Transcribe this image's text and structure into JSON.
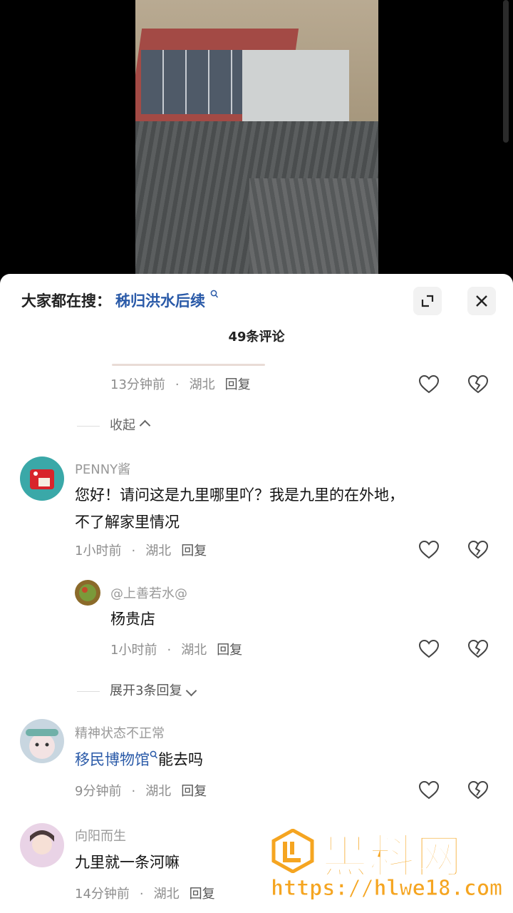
{
  "search_bar": {
    "prefix": "大家都在搜：",
    "keyword": "秭归洪水后续"
  },
  "comment_count": "49条评论",
  "collapse_label": "收起",
  "expand_label": "展开3条回复",
  "comments": [
    {
      "time": "13分钟前",
      "location": "湖北",
      "reply": "回复"
    },
    {
      "username": "PENNY酱",
      "text_line1": "您好！请问这是九里哪里吖？我是九里的在外地，",
      "text_line2": "不了解家里情况",
      "time": "1小时前",
      "location": "湖北",
      "reply": "回复"
    },
    {
      "username": "@上善若水@",
      "text": "杨贵店",
      "time": "1小时前",
      "location": "湖北",
      "reply": "回复"
    },
    {
      "username": "精神状态不正常",
      "link": "移民博物馆",
      "text": "能去吗",
      "time": "9分钟前",
      "location": "湖北",
      "reply": "回复"
    },
    {
      "username": "向阳而生",
      "text": "九里就一条河嘛",
      "time": "14分钟前",
      "location": "湖北",
      "reply": "回复"
    }
  ],
  "watermark": {
    "title": "黑料网",
    "url": "https://hlwe18.com"
  },
  "icons": {
    "search_small": "search-icon",
    "expand": "expand-icon",
    "close": "close-icon",
    "like": "heart-icon",
    "dislike": "broken-heart-icon"
  },
  "colors": {
    "link": "#2a5aa8",
    "watermark": "#f5a521"
  }
}
